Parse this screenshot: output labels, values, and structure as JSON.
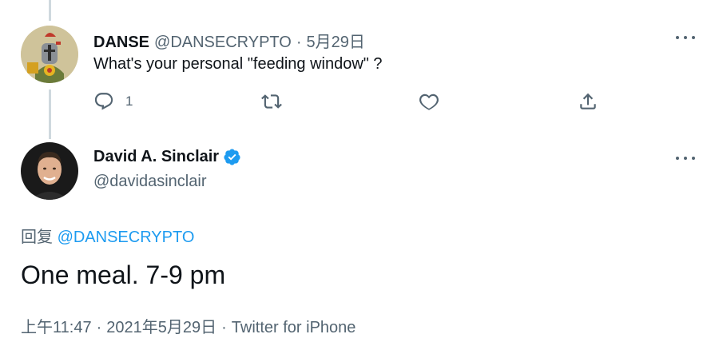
{
  "reply_tweet": {
    "author_name": "DANSE",
    "author_handle": "@DANSECRYPTO",
    "separator": "·",
    "date": "5月29日",
    "text": "What's your personal \"feeding window\" ?",
    "reply_count": "1",
    "avatar_icon": "knight-avatar-icon"
  },
  "main_tweet": {
    "author_name": "David A. Sinclair",
    "author_handle": "@davidasinclair",
    "verified": true,
    "verified_color": "#1d9bf0",
    "replying_label": "回复",
    "replying_mention": "@DANSECRYPTO",
    "text": "One meal. 7-9 pm",
    "time": "上午11:47",
    "separator": "·",
    "date": "2021年5月29日",
    "source": "Twitter for iPhone"
  },
  "colors": {
    "text_primary": "#0f1419",
    "text_secondary": "#536471",
    "link": "#1d9bf0",
    "thread_line": "#cfd9de"
  }
}
